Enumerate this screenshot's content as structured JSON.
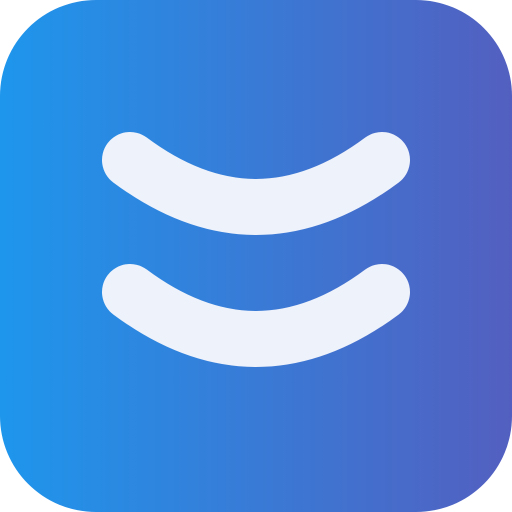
{
  "icon": {
    "name": "double-curve-app-icon",
    "colors": {
      "gradient_start": "#1e96ec",
      "gradient_end": "#535fc0",
      "glyph": "#eef2fa"
    }
  }
}
